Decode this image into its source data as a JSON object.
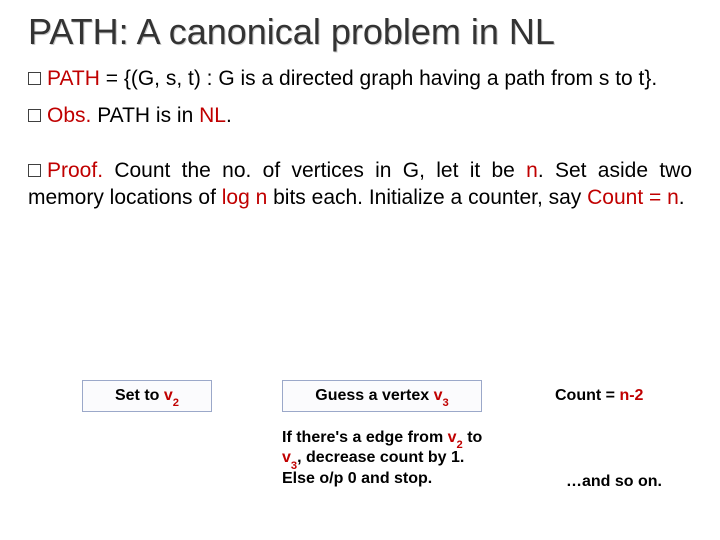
{
  "title": "PATH:  A canonical problem in NL",
  "bullets": {
    "b1": {
      "lead": "PATH",
      "tail": " = {(G, s, t) : G is a directed graph having a path from s to t}."
    },
    "b2": {
      "lead": "Obs.",
      "mid": "  PATH is in ",
      "nl": "NL",
      "tail": "."
    },
    "b3": {
      "lead": "Proof.",
      "p1": " Count the no. of vertices in G, let it be ",
      "n": "n",
      "p2": ". Set aside two memory locations of ",
      "logn": "log n",
      "p3": " bits each. Initialize a counter, say ",
      "count": "Count = n",
      "p4": "."
    }
  },
  "box1": {
    "pre": "Set to ",
    "v": "v",
    "sub": "2"
  },
  "box2": {
    "pre": "Guess a vertex ",
    "v": "v",
    "sub": "3"
  },
  "note_count": {
    "pre": "Count = ",
    "val": "n-2"
  },
  "note_edge": {
    "p1": "If there's a edge from ",
    "v2v": "v",
    "v2s": "2",
    "p2": " to ",
    "v3v": "v",
    "v3s": "3",
    "p3": ", decrease count by 1. Else o/p 0 and stop."
  },
  "note_andso": "…and so on."
}
